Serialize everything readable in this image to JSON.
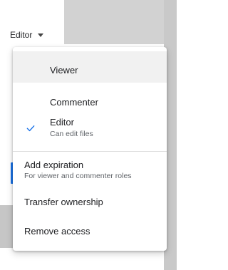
{
  "role_dropdown": {
    "value": "Editor",
    "icon": "caret-down-icon"
  },
  "menu": {
    "roles": [
      {
        "label": "Viewer",
        "selected": false
      },
      {
        "label": "Commenter",
        "selected": false
      },
      {
        "label": "Editor",
        "description": "Can edit files",
        "selected": true
      }
    ],
    "check_icon": "check-icon",
    "actions": {
      "add_expiration": {
        "label": "Add expiration",
        "description": "For viewer and commenter roles"
      },
      "transfer_ownership": {
        "label": "Transfer ownership"
      },
      "remove_access": {
        "label": "Remove access"
      }
    }
  },
  "colors": {
    "accent": "#1a73e8",
    "hover": "#f1f1f1",
    "text": "#202124",
    "secondary_text": "#5f6368"
  }
}
